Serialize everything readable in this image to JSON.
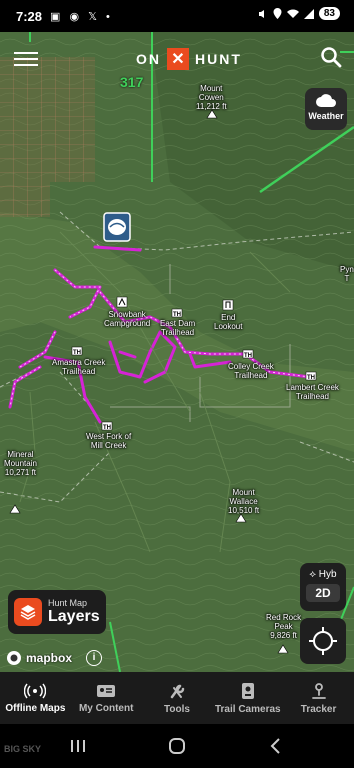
{
  "status_bar": {
    "time": "7:28",
    "notifications": "▣ ◉ 𝕏 •",
    "battery": "83"
  },
  "app": {
    "brand_left": "ON",
    "brand_x": "✕",
    "brand_right": "HUNT"
  },
  "map": {
    "route_badge": "317",
    "labels": [
      {
        "id": "mount-cowen",
        "text": "Mount\nCowen\n11,212 ft"
      },
      {
        "id": "snowbank-campground",
        "text": "Snowbank\nCampground"
      },
      {
        "id": "east-dam-trailhead",
        "text": "East Dam\nTrailhead"
      },
      {
        "id": "end-lookout",
        "text": "End\nLookout"
      },
      {
        "id": "amastra-creek-trailhead",
        "text": "Amastra Creek\nTrailhead"
      },
      {
        "id": "colley-creek-trailhead",
        "text": "Colley Creek\nTrailhead"
      },
      {
        "id": "lambert-creek-trailhead",
        "text": "Lambert Creek\nTrailhead"
      },
      {
        "id": "west-fork-mill-creek",
        "text": "West Fork of\nMill Creek"
      },
      {
        "id": "mineral-mountain",
        "text": "Mineral\nMountain\n10,271 ft"
      },
      {
        "id": "mount-wallace",
        "text": "Mount\nWallace\n10,510 ft"
      },
      {
        "id": "red-rock-peak",
        "text": "Red Rock\nPeak\n9,826 ft"
      },
      {
        "id": "edge-label",
        "text": "Pyn\nT"
      }
    ]
  },
  "controls": {
    "weather_label": "Weather",
    "basemap_label": "Hyb",
    "view_mode": "2D",
    "layers_sub": "Hunt Map",
    "layers_main": "Layers",
    "mapbox_label": "mapbox",
    "info": "i"
  },
  "bottom_nav": [
    {
      "label": "Offline Maps",
      "icon": "offline-maps-icon",
      "active": true
    },
    {
      "label": "My Content",
      "icon": "my-content-icon",
      "active": false
    },
    {
      "label": "Tools",
      "icon": "tools-icon",
      "active": false
    },
    {
      "label": "Trail Cameras",
      "icon": "trail-camera-icon",
      "active": false
    },
    {
      "label": "Tracker",
      "icon": "tracker-icon",
      "active": false
    }
  ],
  "watermark": "BIG SKY",
  "colors": {
    "accent": "#ea4b1f",
    "forest_boundary": "#3fd05a",
    "trail": "#d623d6",
    "terrain": "#4c6d3e"
  }
}
